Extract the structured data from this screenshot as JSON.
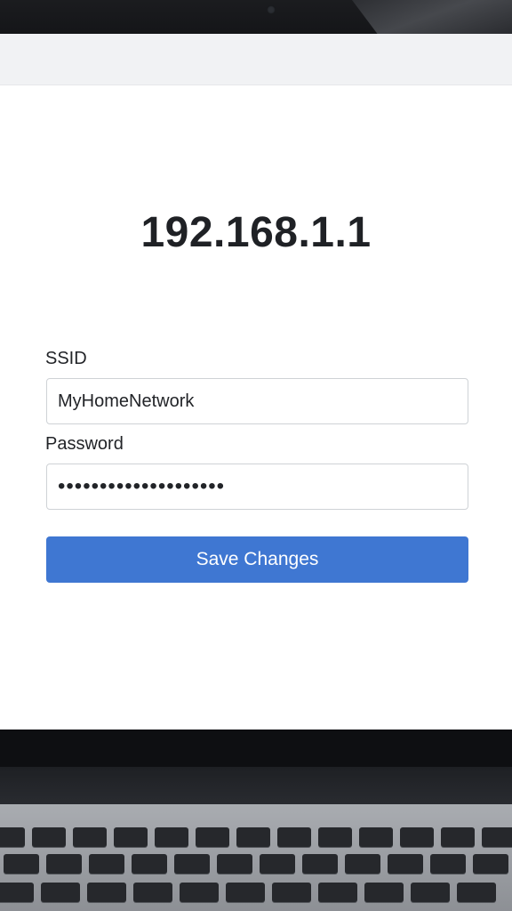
{
  "page": {
    "title": "192.168.1.1"
  },
  "form": {
    "ssid_label": "SSID",
    "ssid_value": "MyHomeNetwork",
    "password_label": "Password",
    "password_value": "••••••••••••••••••••",
    "save_label": "Save Changes"
  },
  "colors": {
    "primary_button": "#3f77d2",
    "background": "#ffffff",
    "text": "#1f2125"
  }
}
